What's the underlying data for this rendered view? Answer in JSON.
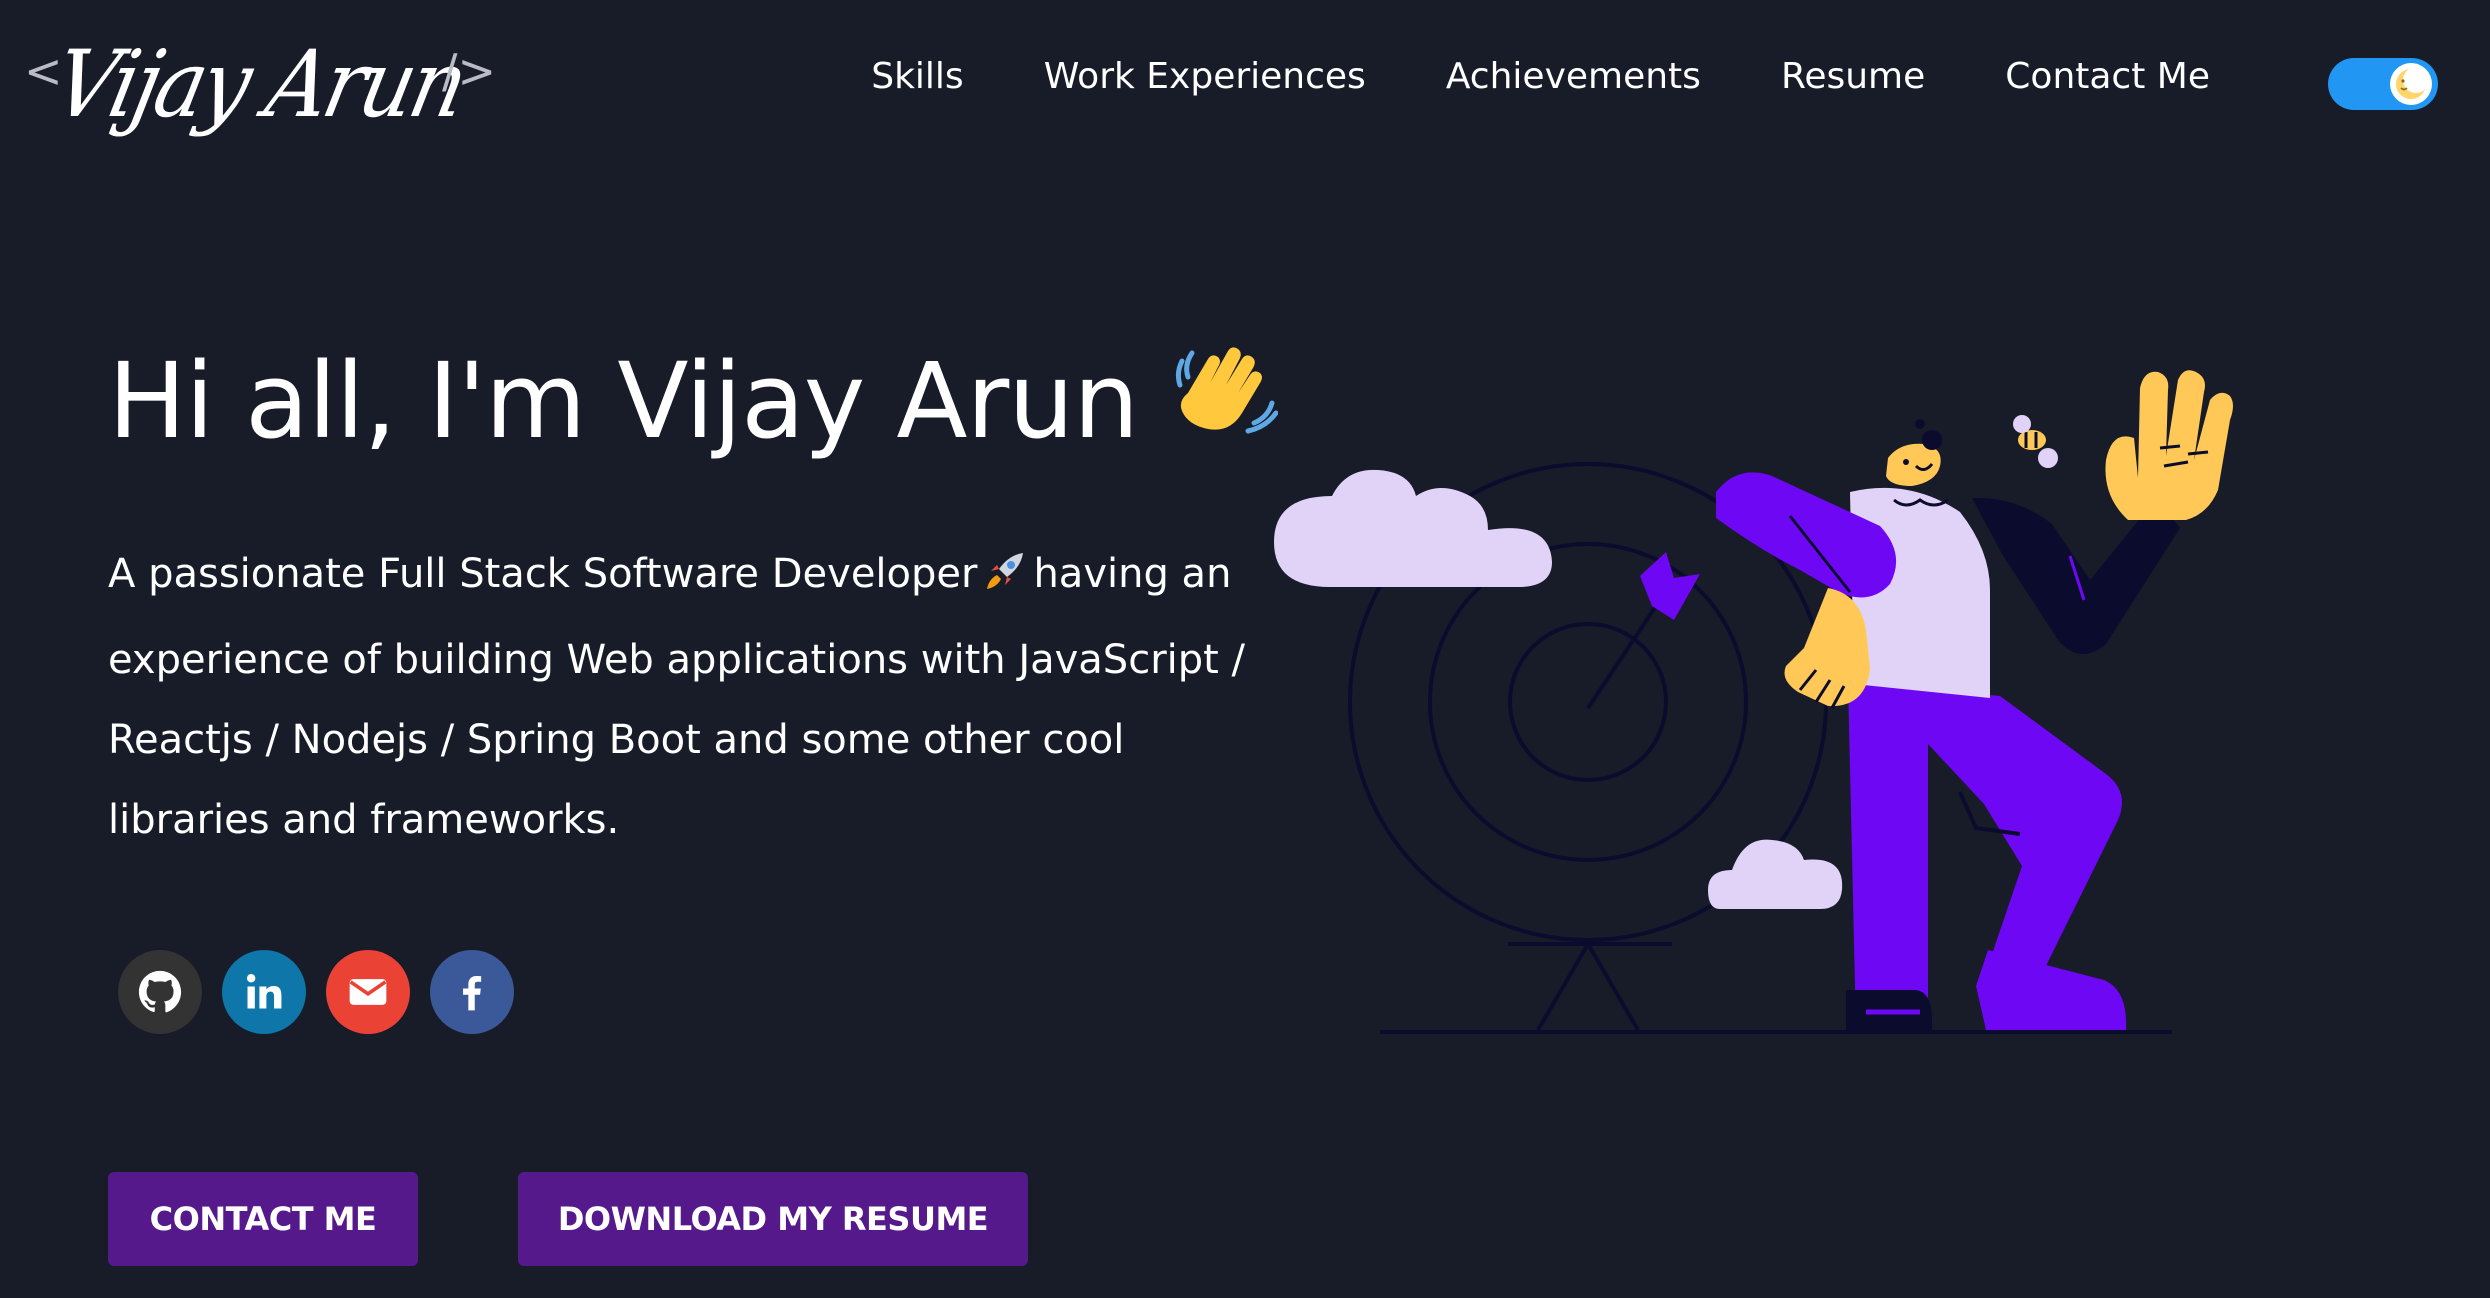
{
  "header": {
    "logo": {
      "open_bracket": "<",
      "name": "Vijay Arun",
      "close_bracket": "/>"
    },
    "nav": [
      {
        "label": "Skills"
      },
      {
        "label": "Work Experiences"
      },
      {
        "label": "Achievements"
      },
      {
        "label": "Resume"
      },
      {
        "label": "Contact Me"
      }
    ],
    "theme_toggle": {
      "state": "dark",
      "icon": "moon-icon"
    }
  },
  "hero": {
    "greeting": "Hi all, I'm Vijay Arun",
    "greeting_emoji": "waving-hand-icon",
    "intro_part1": "A passionate Full Stack Software Developer",
    "intro_emoji": "rocket-icon",
    "intro_part2": "having an experience of building Web applications with JavaScript / Reactjs / Nodejs / Spring Boot and some other cool libraries and frameworks.",
    "socials": [
      {
        "name": "github-icon"
      },
      {
        "name": "linkedin-icon"
      },
      {
        "name": "mail-icon"
      },
      {
        "name": "facebook-icon"
      }
    ],
    "buttons": {
      "contact": "CONTACT ME",
      "resume": "DOWNLOAD MY RESUME"
    }
  },
  "colors": {
    "background": "#171c28",
    "button": "#55198b",
    "toggle": "#2196f3",
    "github": "#333333",
    "linkedin": "#0e76a8",
    "mail": "#ea4335",
    "facebook": "#3b5998",
    "illustration_purple": "#6e07f3",
    "illustration_lavender": "#e1d3f8",
    "illustration_yellow": "#ffc857"
  }
}
